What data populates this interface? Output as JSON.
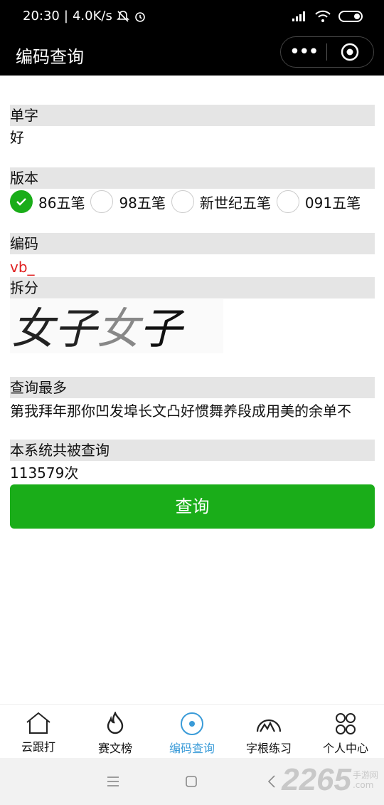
{
  "status_bar": {
    "time": "20:30",
    "speed": "4.0K/s"
  },
  "nav": {
    "title": "编码查询",
    "more": "•••"
  },
  "sections": {
    "single_char": {
      "label": "单字",
      "value": "好"
    },
    "version": {
      "label": "版本",
      "options": [
        {
          "label": "86五笔",
          "checked": true
        },
        {
          "label": "98五笔",
          "checked": false
        },
        {
          "label": "新世纪五笔",
          "checked": false
        },
        {
          "label": "091五笔",
          "checked": false
        }
      ]
    },
    "code": {
      "label": "编码",
      "value": "vb_"
    },
    "split": {
      "label": "拆分",
      "glyphs": "好好"
    },
    "most_queried": {
      "label": "查询最多",
      "value": "第我拜年那你凹发埠长文凸好惯舞养段成用美的余单不"
    },
    "total": {
      "label": "本系统共被查询",
      "value": "113579次"
    }
  },
  "query_button": {
    "label": "查询"
  },
  "tabbar": {
    "tabs": [
      {
        "label": "云跟打",
        "icon": "house-icon",
        "active": false
      },
      {
        "label": "赛文榜",
        "icon": "flame-icon",
        "active": false
      },
      {
        "label": "编码查询",
        "icon": "target-icon",
        "active": true
      },
      {
        "label": "字根练习",
        "icon": "mountain-icon",
        "active": false
      },
      {
        "label": "个人中心",
        "icon": "grid-icon",
        "active": false
      }
    ]
  },
  "watermark": {
    "number": "2265",
    "brand": "手游网",
    "domain": ".com"
  },
  "colors": {
    "primary_green": "#1aad19",
    "active_blue": "#3a9bd8",
    "code_red": "#e02020"
  }
}
